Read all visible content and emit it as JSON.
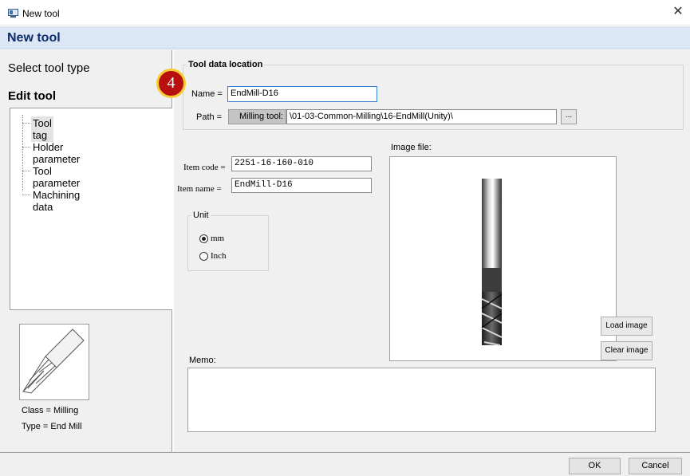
{
  "window": {
    "title": "New tool",
    "close_glyph": "✕",
    "icon": "app-icon"
  },
  "header": {
    "heading": "New tool"
  },
  "nav": {
    "select_tool_type": "Select tool type",
    "edit_tool": "Edit tool",
    "step_badge": "4",
    "tree": [
      {
        "label": "Tool tag",
        "selected": true
      },
      {
        "label": "Holder parameter",
        "selected": false
      },
      {
        "label": "Tool parameter",
        "selected": false
      },
      {
        "label": "Machining data",
        "selected": false
      }
    ]
  },
  "tool_info": {
    "class_label": "Class = Milling",
    "type_label": "Type = End Mill",
    "thumbnail_icon": "end-mill-thumbnail-icon"
  },
  "location": {
    "legend": "Tool data location",
    "name_label": "Name =",
    "name_value": "EndMill-D16",
    "path_label": "Path =",
    "path_button": "Milling tool:",
    "path_value": "\\01-03-Common-Milling\\16-EndMill(Unity)\\",
    "browse_button": "..."
  },
  "item": {
    "code_label": "Item code =",
    "code_value": "2251-16-160-010",
    "name_label": "Item name =",
    "name_value": "EndMill-D16"
  },
  "unit": {
    "legend": "Unit",
    "options": [
      {
        "label": "mm",
        "selected": true
      },
      {
        "label": "Inch",
        "selected": false
      }
    ]
  },
  "image": {
    "label": "Image file:",
    "load_button": "Load image",
    "clear_button": "Clear image",
    "picture_icon": "end-mill-photo"
  },
  "memo": {
    "label": "Memo:",
    "value": ""
  },
  "footer": {
    "ok": "OK",
    "cancel": "Cancel"
  },
  "colors": {
    "header_band": "#dbe7f4",
    "heading_text": "#0d2d6b",
    "badge_fill": "#b80f0f",
    "badge_ring": "#f4cd32",
    "input_focus": "#3b7ed6"
  }
}
